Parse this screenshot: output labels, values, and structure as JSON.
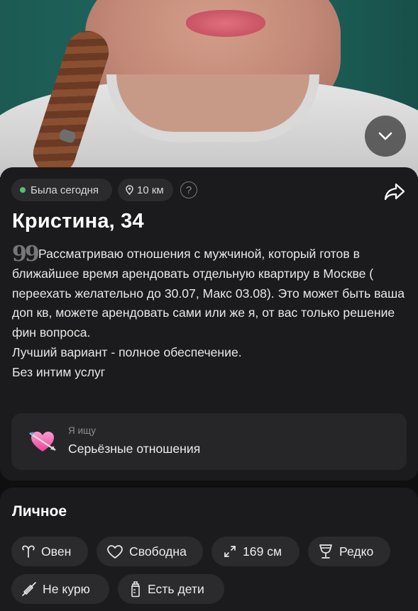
{
  "photo": {
    "alt_icon": "photo"
  },
  "controls": {
    "expand_icon": "chevron-down-icon",
    "share_icon": "share-arrow-icon"
  },
  "status": {
    "online_text": "Была сегодня",
    "online_color": "#4fc36b",
    "distance_text": "10 км",
    "help_glyph": "?"
  },
  "profile": {
    "name_age": "Кристина, 34",
    "quote_glyph": "99",
    "bio": "Рассматриваю отношения с мужчиной, который готов в ближайшее время арендовать отдельную квартиру в Москве ( переехать желательно до 30.07, Макс 03.08). Это может быть ваша доп кв, можете арендовать сами или же я, от вас только решение фин вопроса.\nЛучший вариант - полное обеспечение.\nБез интим услуг"
  },
  "looking_for": {
    "label": "Я ищу",
    "value": "Серьёзные отношения",
    "icon": "heart-arrow-icon"
  },
  "personal": {
    "title": "Личное",
    "tags": [
      {
        "label": "Овен",
        "icon": "aries-icon"
      },
      {
        "label": "Свободна",
        "icon": "heart-outline-icon"
      },
      {
        "label": "169 см",
        "icon": "height-arrows-icon"
      },
      {
        "label": "Редко",
        "icon": "wine-glass-icon"
      },
      {
        "label": "Не курю",
        "icon": "no-smoking-icon"
      },
      {
        "label": "Есть дети",
        "icon": "baby-bottle-icon"
      }
    ]
  },
  "colors": {
    "background": "#0f0f10",
    "card": "#1b1b1d",
    "pill": "#2b2b2e",
    "text": "#ffffff",
    "muted": "#8e8e8e"
  }
}
